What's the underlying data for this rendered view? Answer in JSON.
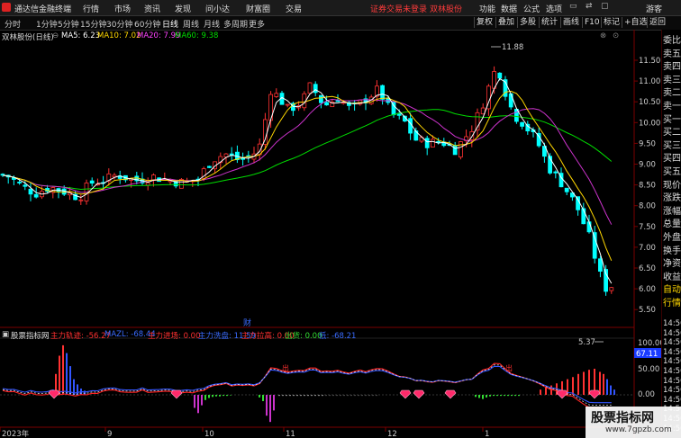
{
  "menu": {
    "app_title": "通达信金融终端",
    "items": [
      "行情",
      "市场",
      "资讯",
      "发现",
      "问小达",
      "财富圈",
      "交易"
    ],
    "login_text": "证券交易未登录",
    "broker": "双林股份",
    "right_items": [
      "功能",
      "数据",
      "公式",
      "选项"
    ],
    "guest": "游客"
  },
  "toolbar": {
    "periods": [
      "分时",
      "1分钟",
      "5分钟",
      "15分钟",
      "30分钟",
      "60分钟",
      "日线",
      "周线",
      "月线",
      "多周期",
      "更多"
    ],
    "active_period": "日线",
    "buttons": [
      "复权",
      "叠加",
      "多股",
      "统计",
      "画线",
      "F10",
      "标记",
      "+自选",
      "返回"
    ]
  },
  "chart_header": {
    "stock": "双林股份(日线)",
    "ma5_label": "MA5: 6.23",
    "ma10_label": "MA10: 7.02",
    "ma20_label": "MA20: 7.99",
    "ma60_label": "MA60: 9.38",
    "ma_colors": {
      "ma5": "#ffffff",
      "ma10": "#ffd700",
      "ma20": "#ff44ff",
      "ma60": "#00dd00"
    }
  },
  "indicator_header": {
    "name": "股票指标网",
    "main_track": "主力轨迹: -56.27",
    "mazl": "MAZL: -68.44",
    "main_enter": "主力进场: 0.00",
    "main_wash": "主力洗盘: 11.59",
    "main_lift": "主力拉高: 0.00",
    "exit": "出货: 0.00",
    "low": "低: -68.21"
  },
  "price_axis": [
    "11.50",
    "11.00",
    "10.50",
    "10.00",
    "9.50",
    "9.00",
    "8.50",
    "8.00",
    "7.50",
    "7.00",
    "6.50",
    "6.00",
    "5.50"
  ],
  "indicator_axis": [
    "100.00",
    "50.00",
    "0.00"
  ],
  "indicator_value_box": "67.11",
  "date_labels": [
    "2023年",
    "9",
    "10",
    "11",
    "12",
    "1"
  ],
  "annotations": {
    "high": "11.88",
    "low": "5.37",
    "cai_marker": "财",
    "out_marker": "出"
  },
  "right_panel": [
    "委比",
    "卖五",
    "卖四",
    "卖三",
    "卖二",
    "卖一",
    "买一",
    "买二",
    "买三",
    "买四",
    "买五",
    "现价",
    "涨跌",
    "涨幅",
    "总量",
    "外盘",
    "换手",
    "净资",
    "收益",
    "自动",
    "行情"
  ],
  "time_ticks": [
    "14:50",
    "14:50",
    "14:50",
    "14:50",
    "14:50",
    "14:50",
    "14:50",
    "14:50",
    "14:50",
    "14:50",
    "14:50",
    "14:50"
  ],
  "watermark": {
    "line1": "股票指标网",
    "line2": "www.7gpzb.com"
  },
  "colors": {
    "up": "#ff3232",
    "down": "#00ffff",
    "accent_red": "#ff3b3b",
    "purple": "#cc33cc",
    "green": "#33dd33",
    "blue_ind": "#3355ff"
  }
}
